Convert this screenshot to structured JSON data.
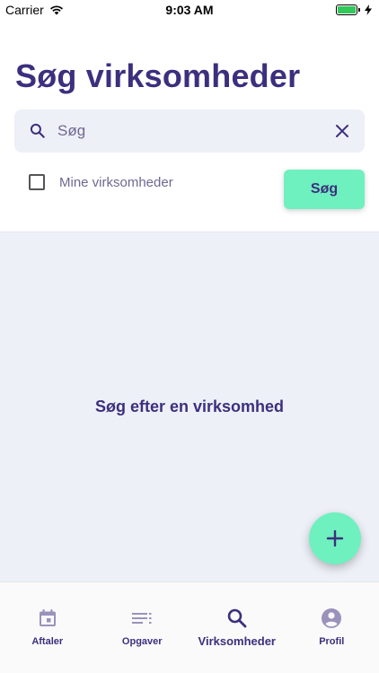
{
  "status_bar": {
    "carrier": "Carrier",
    "time": "9:03 AM",
    "battery_level": 1.0
  },
  "header": {
    "title": "Søg virksomheder"
  },
  "search": {
    "placeholder": "Søg",
    "search_icon": "search-icon",
    "clear_icon": "close-icon"
  },
  "filter": {
    "checkbox_label": "Mine virksomheder",
    "checked": false
  },
  "search_button": {
    "label": "Søg"
  },
  "content": {
    "empty_message": "Søg efter en virksomhed"
  },
  "fab": {
    "icon": "plus-icon"
  },
  "tab_bar": {
    "items": [
      {
        "label": "Aftaler",
        "icon": "calendar-icon",
        "active": false
      },
      {
        "label": "Opgaver",
        "icon": "list-icon",
        "active": false
      },
      {
        "label": "Virksomheder",
        "icon": "search-icon",
        "active": true
      },
      {
        "label": "Profil",
        "icon": "profile-icon",
        "active": false
      }
    ]
  },
  "colors": {
    "primary": "#3d2f7e",
    "accent": "#6ff0bf",
    "content_background": "#edf0f7",
    "search_background": "#eef0f7",
    "inactive_icon": "#9a92bb"
  }
}
